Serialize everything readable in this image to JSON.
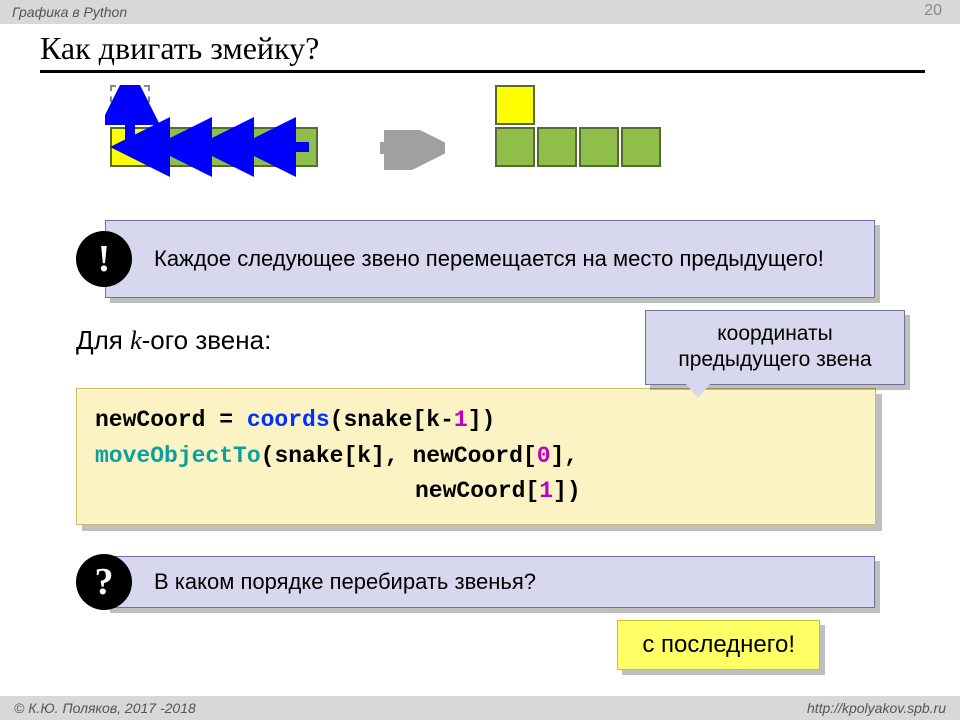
{
  "header": {
    "subject": "Графика в Python",
    "page": "20"
  },
  "title": "Как двигать змейку?",
  "note1": "Каждое следующее звено перемещается на место предыдущего!",
  "bang": "!",
  "subhead": {
    "pre": "Для ",
    "k": "k",
    "post": "-ого звена:"
  },
  "callout": "координаты предыдущего звена",
  "code": {
    "l1a": "newCoord = ",
    "l1b": "coords",
    "l1c": "(snake[k-",
    "l1d": "1",
    "l1e": "])",
    "l2a": "moveObjectTo",
    "l2b": "(snake[k], newCoord[",
    "l2c": "0",
    "l2d": "],",
    "l3a": "newCoord[",
    "l3b": "1",
    "l3c": "])"
  },
  "note2": "В каком порядке перебирать звенья?",
  "qmark": "?",
  "answer": "с последнего!",
  "footer": {
    "left": "© К.Ю. Поляков, 2017 -2018",
    "right": "http://kpolyakov.spb.ru"
  }
}
